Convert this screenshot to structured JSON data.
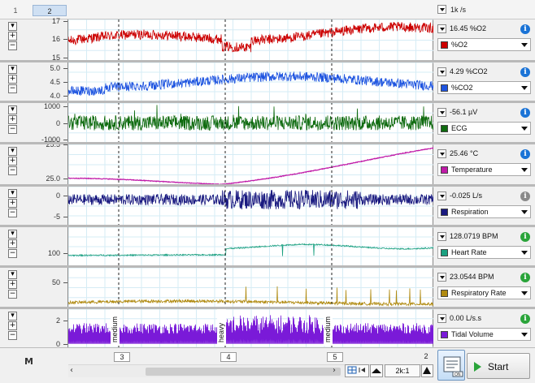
{
  "window": {
    "page_tabs": [
      "1",
      "2"
    ],
    "sample_rate": "1k /s"
  },
  "channels": [
    {
      "id": "o2",
      "name": "%O2",
      "value": "16.45 %O2",
      "color": "#cc0000",
      "info_color": "#1a73d6",
      "ticks": [
        "17",
        "16",
        "15"
      ],
      "range": [
        14.8,
        17.1
      ]
    },
    {
      "id": "co2",
      "name": "%CO2",
      "value": "4.29 %CO2",
      "color": "#1f55e0",
      "info_color": "#1a73d6",
      "ticks": [
        "5.0",
        "4.5",
        "4.0"
      ],
      "range": [
        3.8,
        5.2
      ]
    },
    {
      "id": "ecg",
      "name": "ECG",
      "value": "-56.1 µV",
      "color": "#0f6b0f",
      "info_color": "#1a73d6",
      "ticks": [
        "1000",
        "0",
        "-1000"
      ],
      "range": [
        -1200,
        1200
      ]
    },
    {
      "id": "temp",
      "name": "Temperature",
      "value": "25.46 °C",
      "color": "#c01aa8",
      "info_color": "#1a73d6",
      "ticks": [
        "25.5",
        "25.0"
      ],
      "range": [
        24.9,
        25.5
      ]
    },
    {
      "id": "resp",
      "name": "Respiration",
      "value": "-0.025 L/s",
      "color": "#1a1a80",
      "info_color": "#8a8a8a",
      "ticks": [
        "0",
        "-5"
      ],
      "range": [
        -7,
        2
      ]
    },
    {
      "id": "hr",
      "name": "Heart Rate",
      "value": "128.0719 BPM",
      "color": "#1aa080",
      "info_color": "#2aa43a",
      "ticks": [
        "100"
      ],
      "range": [
        70,
        160
      ]
    },
    {
      "id": "rr",
      "name": "Respiratory Rate",
      "value": "23.0544 BPM",
      "color": "#b08a10",
      "info_color": "#2aa43a",
      "ticks": [
        "50"
      ],
      "range": [
        0,
        80
      ]
    },
    {
      "id": "tv",
      "name": "Tidal Volume",
      "value": "0.00 L/s.s",
      "color": "#7a1ad8",
      "info_color": "#2aa43a",
      "ticks": [
        "2",
        "0"
      ],
      "range": [
        -0.3,
        3
      ]
    }
  ],
  "comments": [
    {
      "label": "medium",
      "marker": "3"
    },
    {
      "label": "heavy",
      "marker": "4"
    },
    {
      "label": "medium",
      "marker": "5"
    }
  ],
  "axis_end_label": "2",
  "bottom": {
    "m_icon": "M",
    "zoom_label": "2k:1",
    "start_label": "Start"
  },
  "icons": {
    "info": "info-icon",
    "dropdown": "dropdown-icon",
    "plus": "plus-icon",
    "minus": "minus-icon",
    "start": "play-icon"
  }
}
